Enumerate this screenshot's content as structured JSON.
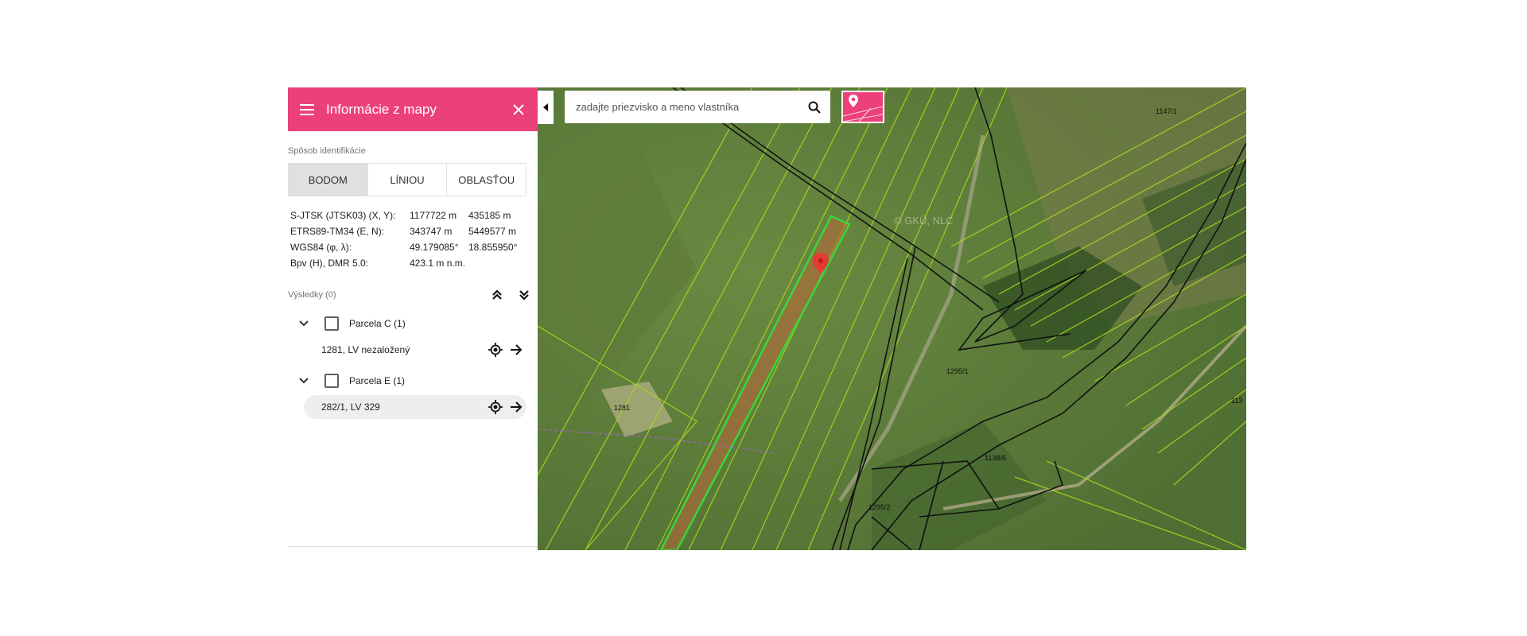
{
  "panel": {
    "title": "Informácie z mapy",
    "menu_icon": "menu-icon",
    "close_icon": "close-icon",
    "identification_label": "Spôsob identifikácie",
    "modes": [
      "BODOM",
      "LÍNIOU",
      "OBLASŤOU"
    ],
    "active_mode": "BODOM",
    "coordinates": [
      {
        "label": "S-JTSK (JTSK03) (X, Y):",
        "v1": "1177722 m",
        "v2": "435185 m"
      },
      {
        "label": "ETRS89-TM34 (E, N):",
        "v1": "343747 m",
        "v2": "5449577 m"
      },
      {
        "label": "WGS84 (φ, λ):",
        "v1": "49.179085°",
        "v2": "18.855950°"
      },
      {
        "label": "Bpv (H), DMR 5.0:",
        "v1": "423.1 m n.m.",
        "v2": ""
      }
    ],
    "results_label": "Výsledky (0)",
    "groups": [
      {
        "label": "Parcela C (1)",
        "item": "1281, LV nezaložený"
      },
      {
        "label": "Parcela E (1)",
        "item": "282/1, LV 329"
      }
    ]
  },
  "search": {
    "placeholder": "zadajte priezvisko a meno vlastníka"
  },
  "map": {
    "watermark": "© GKÚ, NLC",
    "labels": [
      "1147/1",
      "1295/1",
      "1281",
      "1138/6",
      "1295/2",
      "113"
    ],
    "highlight_color": "#39d63a",
    "parcel_line_color": "#a8d81c",
    "marker_color": "#e53935"
  }
}
